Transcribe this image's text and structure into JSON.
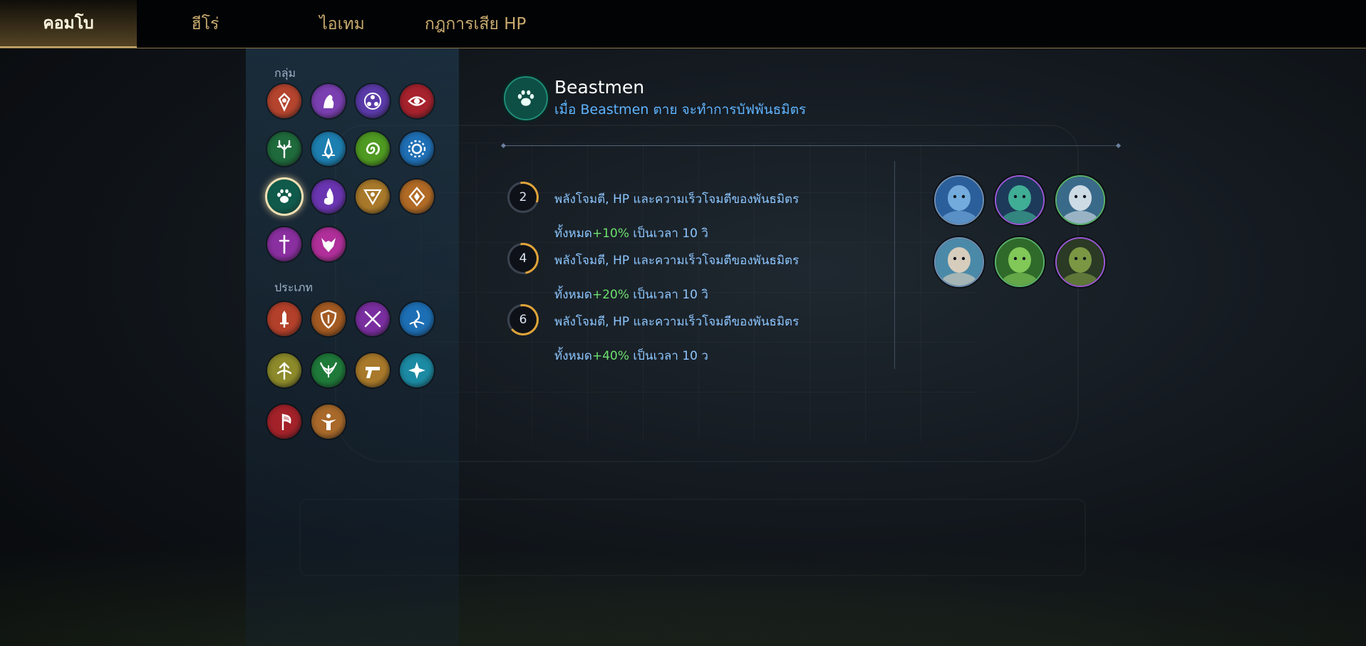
{
  "nav": {
    "tabs": [
      {
        "label": "คอมโบ",
        "active": true
      },
      {
        "label": "ฮีโร่",
        "active": false
      },
      {
        "label": "ไอเทม",
        "active": false
      },
      {
        "label": "กฎการเสีย HP",
        "active": false
      }
    ]
  },
  "sidebar": {
    "group_label": "กลุ่ม",
    "type_label": "ประเภท",
    "group_icons": [
      {
        "name": "crimson-emblem-icon",
        "color": "#b4442e"
      },
      {
        "name": "purple-beast-icon",
        "color": "#7a3fb0"
      },
      {
        "name": "arcane-triangle-icon",
        "color": "#5a3aa8"
      },
      {
        "name": "red-eye-icon",
        "color": "#a6222d"
      },
      {
        "name": "antler-icon",
        "color": "#1f6b3c"
      },
      {
        "name": "blue-spire-icon",
        "color": "#1d7fb0"
      },
      {
        "name": "green-swirl-icon",
        "color": "#4f9a22"
      },
      {
        "name": "blue-gear-icon",
        "color": "#1f6fb5"
      },
      {
        "name": "paw-icon",
        "color": "#0f5a4a",
        "selected": true
      },
      {
        "name": "purple-flame-icon",
        "color": "#6a35b0"
      },
      {
        "name": "gold-eye-triangle-icon",
        "color": "#a8792a"
      },
      {
        "name": "bronze-diamond-icon",
        "color": "#b06a25"
      },
      {
        "name": "purple-sword-icon",
        "color": "#8a2fa0"
      },
      {
        "name": "fox-icon",
        "color": "#b02f9a"
      }
    ],
    "type_icons": [
      {
        "name": "red-sword-icon",
        "color": "#b3402a"
      },
      {
        "name": "bronze-shield-icon",
        "color": "#a35a22"
      },
      {
        "name": "crossed-swords-icon",
        "color": "#7a2fa0"
      },
      {
        "name": "blue-wave-icon",
        "color": "#1d6fb5"
      },
      {
        "name": "gold-arrow-icon",
        "color": "#8c8a2a"
      },
      {
        "name": "green-wings-icon",
        "color": "#1f7a3a"
      },
      {
        "name": "gold-pistol-icon",
        "color": "#a8792a"
      },
      {
        "name": "cyan-compass-icon",
        "color": "#1c8aa3"
      },
      {
        "name": "red-axe-icon",
        "color": "#a3222a"
      },
      {
        "name": "gold-figure-icon",
        "color": "#a8692a"
      }
    ]
  },
  "detail": {
    "title": "Beastmen",
    "description": "เมื่อ Beastmen ตาย จะทำการบัฟพันธมิตร",
    "icon": "paw-icon",
    "tiers": [
      {
        "count": "2",
        "line1": "พลังโจมตี, HP และความเร็วโจมตีของพันธมิตร",
        "prefix": "ทั้งหมด",
        "pct": "+10%",
        "suffix": " เป็นเวลา 10 วิ"
      },
      {
        "count": "4",
        "line1": "พลังโจมตี, HP และความเร็วโจมตีของพันธมิตร",
        "prefix": "ทั้งหมด",
        "pct": "+20%",
        "suffix": " เป็นเวลา 10 วิ"
      },
      {
        "count": "6",
        "line1": "พลังโจมตี, HP และความเร็วโจมตีของพันธมิตร",
        "prefix": "ทั้งหมด",
        "pct": "+40%",
        "suffix": " เป็นเวลา 10 ว"
      }
    ],
    "heroes": [
      {
        "name": "hero-portrait-1"
      },
      {
        "name": "hero-portrait-2"
      },
      {
        "name": "hero-portrait-3"
      },
      {
        "name": "hero-portrait-4"
      },
      {
        "name": "hero-portrait-5"
      },
      {
        "name": "hero-portrait-6"
      }
    ]
  },
  "colors": {
    "accent_gold": "#c8aa6e",
    "tier_ring_gold": "#e0a43a",
    "description_blue": "#5fb4ff",
    "tier_text_blue": "#8dc6ff",
    "percent_green": "#6ee06e"
  }
}
